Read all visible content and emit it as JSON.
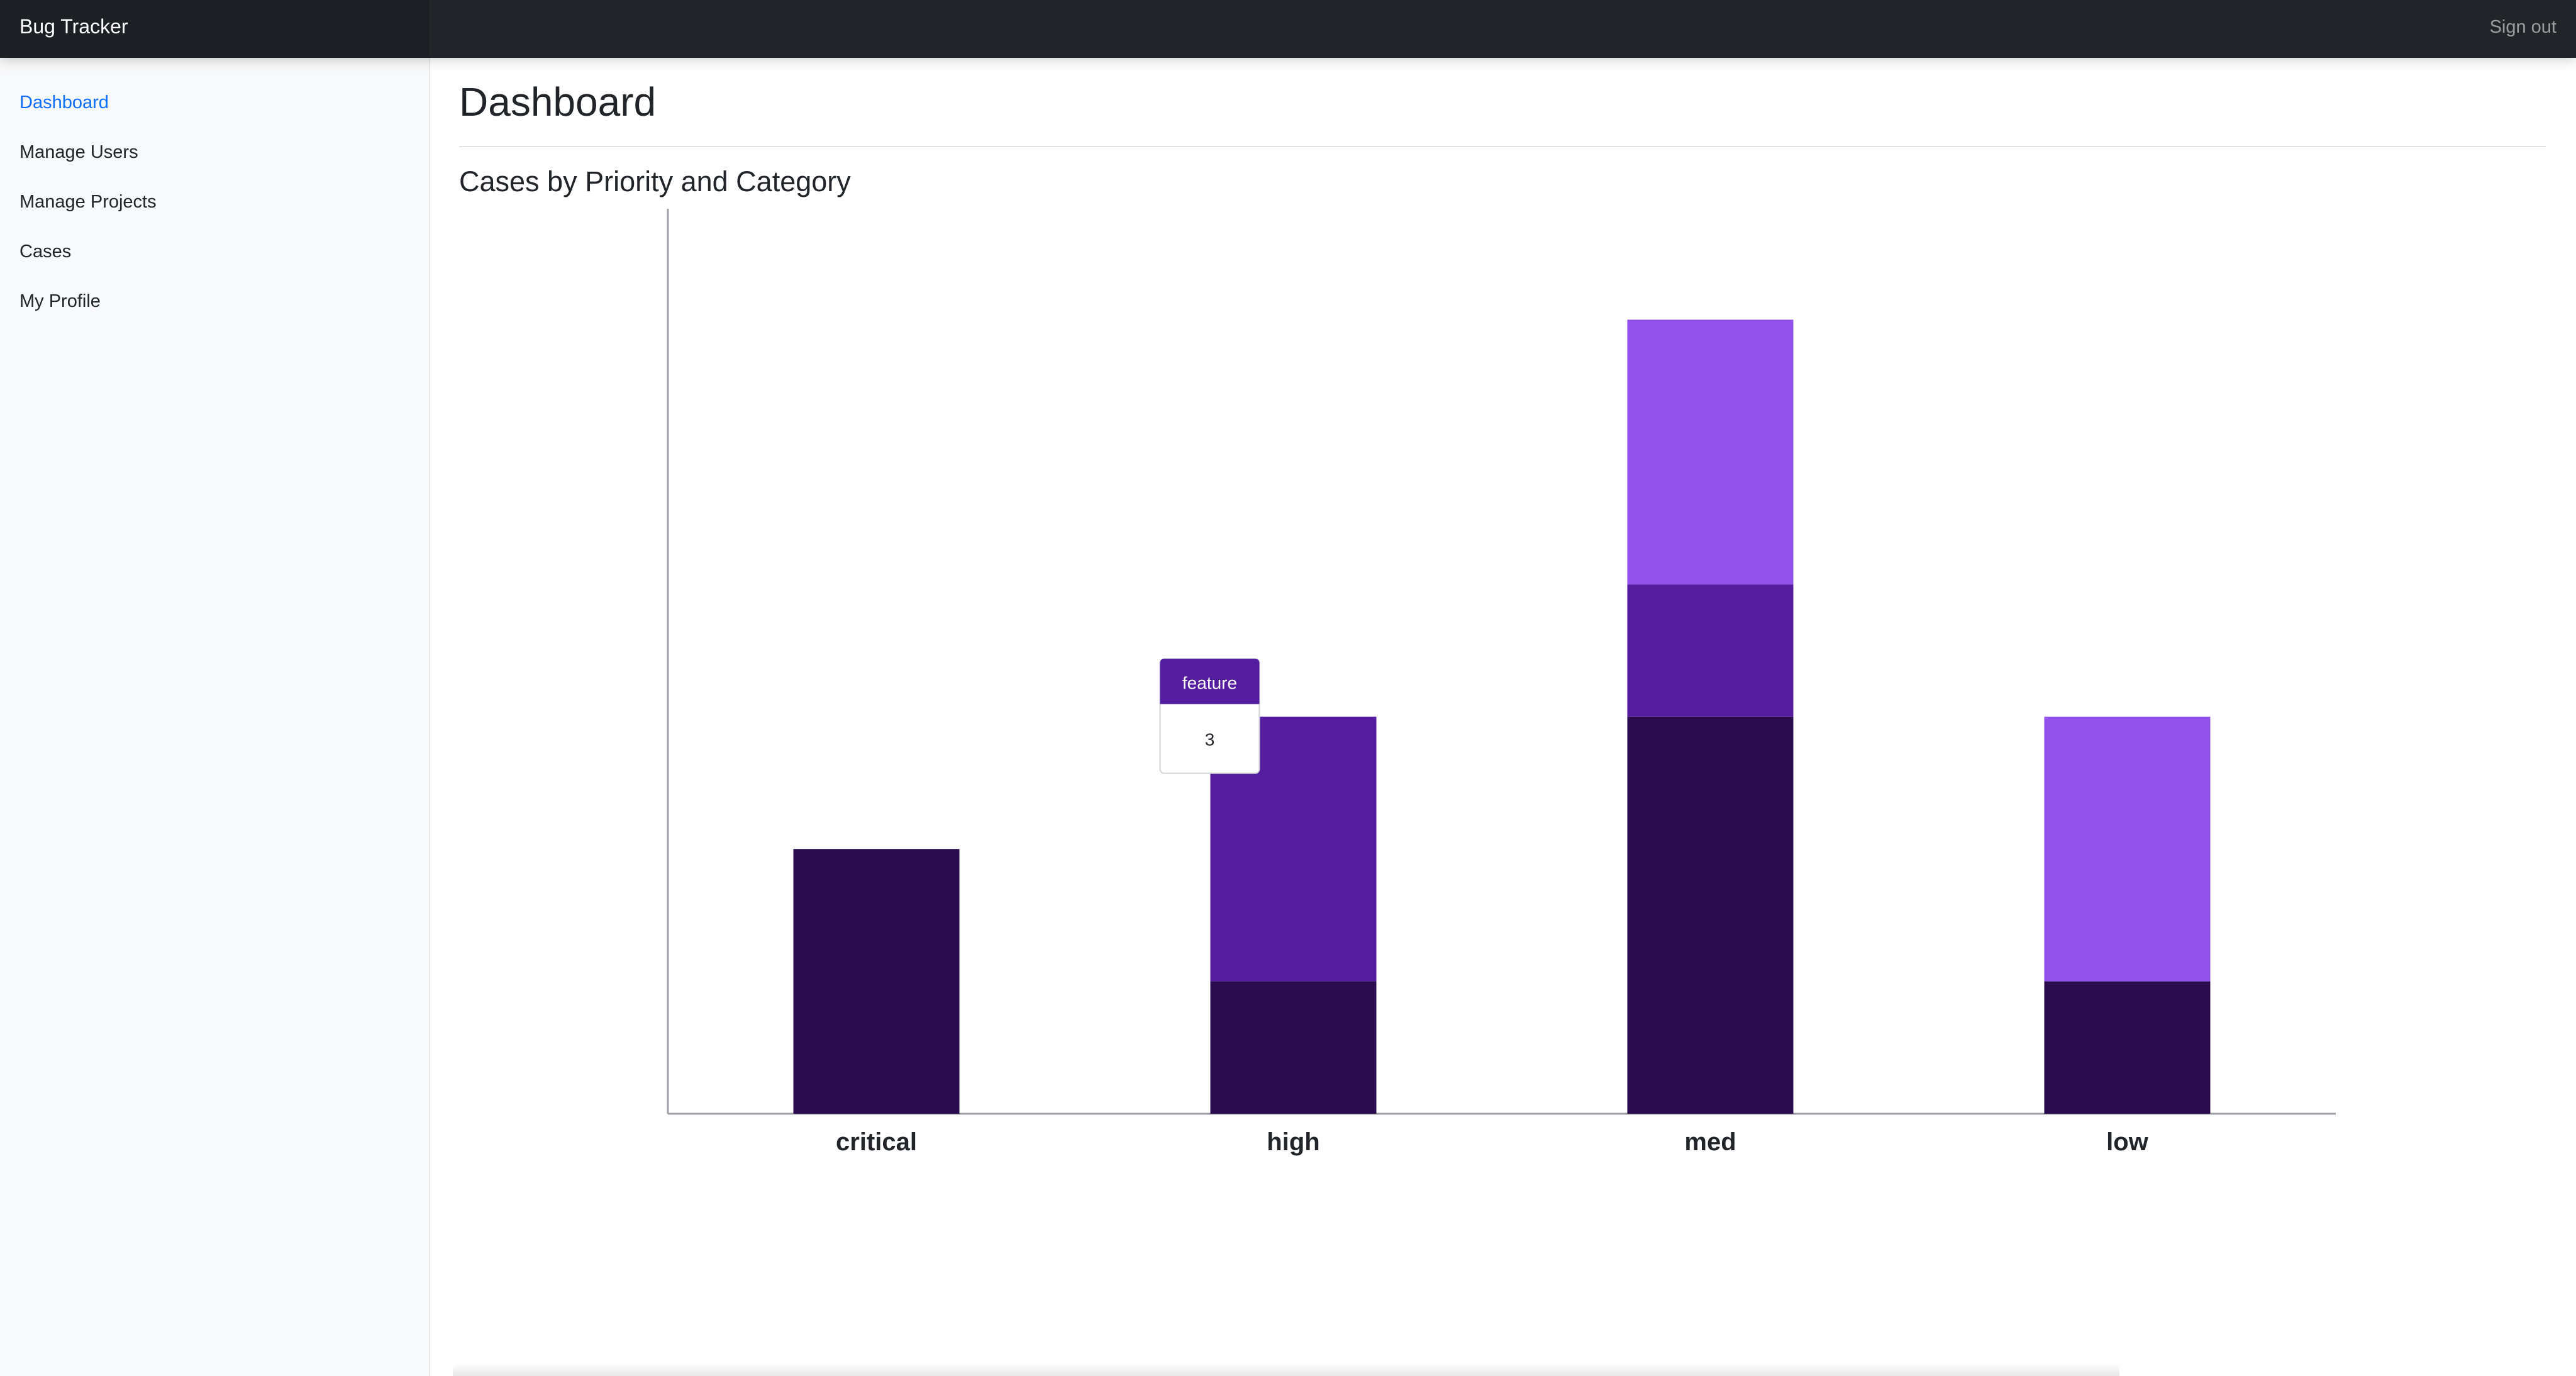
{
  "app": {
    "title": "Bug Tracker",
    "sign_out": "Sign out"
  },
  "sidebar": {
    "items": [
      {
        "label": "Dashboard",
        "active": true
      },
      {
        "label": "Manage Users",
        "active": false
      },
      {
        "label": "Manage Projects",
        "active": false
      },
      {
        "label": "Cases",
        "active": false
      },
      {
        "label": "My Profile",
        "active": false
      }
    ]
  },
  "page": {
    "title": "Dashboard",
    "section_title": "Cases by Priority and Category"
  },
  "colors": {
    "topbar": "#212529",
    "active_link": "#0d6efd",
    "series_1": "#2a0c4e",
    "series_2": "#541da0",
    "series_3": "#9251eb"
  },
  "chart_data": {
    "type": "bar",
    "stacked": true,
    "categories": [
      "critical",
      "high",
      "med",
      "low"
    ],
    "series": [
      {
        "name": "",
        "color": "#2a0c4e",
        "values": [
          2,
          1,
          3,
          1
        ]
      },
      {
        "name": "feature",
        "color": "#541da0",
        "values": [
          0,
          2,
          1,
          0
        ]
      },
      {
        "name": "",
        "color": "#9251eb",
        "values": [
          0,
          0,
          2,
          2
        ]
      }
    ],
    "ylim": [
      0,
      6.8
    ],
    "grid": false,
    "tooltip": {
      "title": "feature",
      "value": "3",
      "category": "high"
    }
  }
}
